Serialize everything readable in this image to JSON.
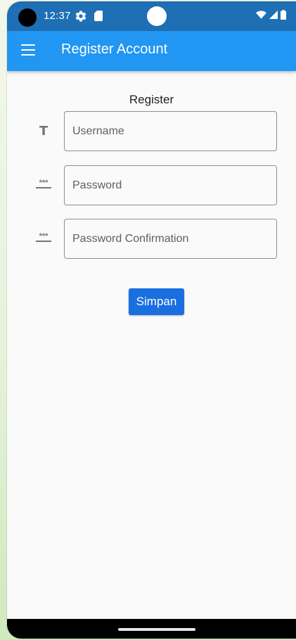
{
  "status_bar": {
    "time": "12:37",
    "icons": [
      "gear-icon",
      "sd-card-icon",
      "wifi-icon",
      "signal-icon",
      "battery-icon"
    ]
  },
  "app_bar": {
    "menu_icon": "menu-icon",
    "title": "Register Account"
  },
  "form": {
    "title": "Register",
    "fields": [
      {
        "icon": "text-icon",
        "icon_glyph": "T",
        "placeholder": "Username",
        "value": ""
      },
      {
        "icon": "password-icon",
        "icon_glyph": "***",
        "placeholder": "Password",
        "value": ""
      },
      {
        "icon": "password-icon",
        "icon_glyph": "***",
        "placeholder": "Password Confirmation",
        "value": ""
      }
    ],
    "submit_label": "Simpan"
  },
  "colors": {
    "status_bar": "#1e6fb4",
    "app_bar": "#2196f3",
    "button": "#1a6fe0",
    "background": "#fafafa"
  }
}
